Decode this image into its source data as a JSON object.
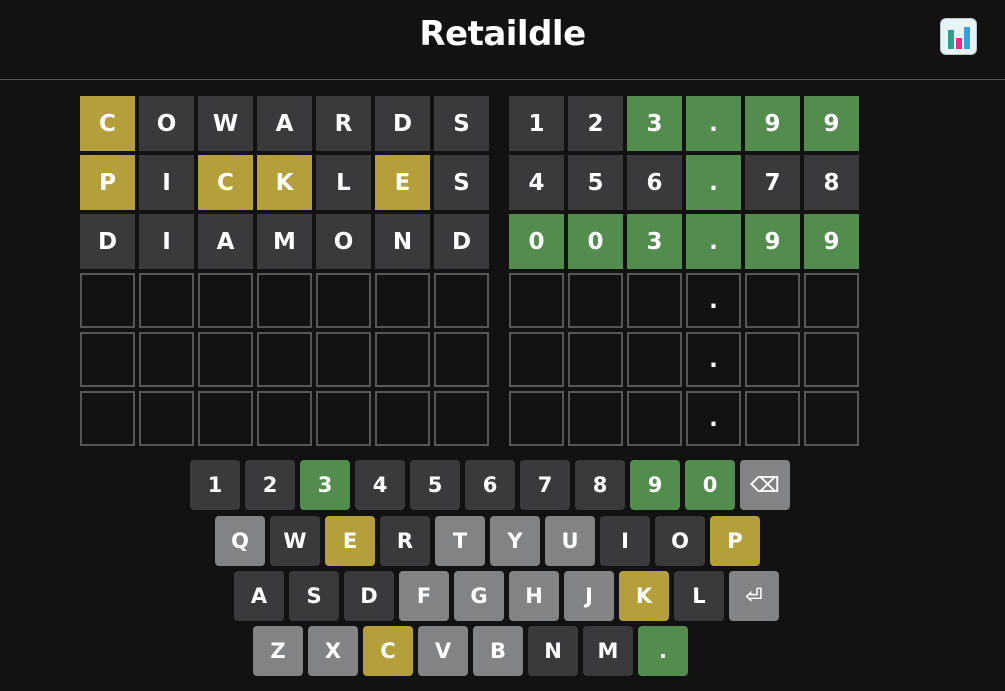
{
  "header": {
    "title": "Retaildle",
    "stats_icon": "bar-chart-icon"
  },
  "board": {
    "rows": [
      {
        "word": [
          [
            "C",
            "present"
          ],
          [
            "O",
            "filled"
          ],
          [
            "W",
            "filled"
          ],
          [
            "A",
            "filled"
          ],
          [
            "R",
            "filled"
          ],
          [
            "D",
            "filled"
          ],
          [
            "S",
            "filled"
          ]
        ],
        "price": [
          [
            "1",
            "filled"
          ],
          [
            "2",
            "filled"
          ],
          [
            "3",
            "correct"
          ],
          [
            ".",
            "correct"
          ],
          [
            "9",
            "correct"
          ],
          [
            "9",
            "correct"
          ]
        ]
      },
      {
        "word": [
          [
            "P",
            "present"
          ],
          [
            "I",
            "filled"
          ],
          [
            "C",
            "present"
          ],
          [
            "K",
            "present"
          ],
          [
            "L",
            "filled"
          ],
          [
            "E",
            "present"
          ],
          [
            "S",
            "filled"
          ]
        ],
        "price": [
          [
            "4",
            "filled"
          ],
          [
            "5",
            "filled"
          ],
          [
            "6",
            "filled"
          ],
          [
            ".",
            "correct"
          ],
          [
            "7",
            "filled"
          ],
          [
            "8",
            "filled"
          ]
        ]
      },
      {
        "word": [
          [
            "D",
            "filled"
          ],
          [
            "I",
            "filled"
          ],
          [
            "A",
            "filled"
          ],
          [
            "M",
            "filled"
          ],
          [
            "O",
            "filled"
          ],
          [
            "N",
            "filled"
          ],
          [
            "D",
            "filled"
          ]
        ],
        "price": [
          [
            "0",
            "correct"
          ],
          [
            "0",
            "correct"
          ],
          [
            "3",
            "correct"
          ],
          [
            ".",
            "correct"
          ],
          [
            "9",
            "correct"
          ],
          [
            "9",
            "correct"
          ]
        ]
      },
      {
        "word": [
          [
            "",
            "empty"
          ],
          [
            "",
            "empty"
          ],
          [
            "",
            "empty"
          ],
          [
            "",
            "empty"
          ],
          [
            "",
            "empty"
          ],
          [
            "",
            "empty"
          ],
          [
            "",
            "empty"
          ]
        ],
        "price": [
          [
            "",
            "empty"
          ],
          [
            "",
            "empty"
          ],
          [
            "",
            "empty"
          ],
          [
            ".",
            "empty"
          ],
          [
            "",
            "empty"
          ],
          [
            "",
            "empty"
          ]
        ]
      },
      {
        "word": [
          [
            "",
            "empty"
          ],
          [
            "",
            "empty"
          ],
          [
            "",
            "empty"
          ],
          [
            "",
            "empty"
          ],
          [
            "",
            "empty"
          ],
          [
            "",
            "empty"
          ],
          [
            "",
            "empty"
          ]
        ],
        "price": [
          [
            "",
            "empty"
          ],
          [
            "",
            "empty"
          ],
          [
            "",
            "empty"
          ],
          [
            ".",
            "empty"
          ],
          [
            "",
            "empty"
          ],
          [
            "",
            "empty"
          ]
        ]
      },
      {
        "word": [
          [
            "",
            "empty"
          ],
          [
            "",
            "empty"
          ],
          [
            "",
            "empty"
          ],
          [
            "",
            "empty"
          ],
          [
            "",
            "empty"
          ],
          [
            "",
            "empty"
          ],
          [
            "",
            "empty"
          ]
        ],
        "price": [
          [
            "",
            "empty"
          ],
          [
            "",
            "empty"
          ],
          [
            "",
            "empty"
          ],
          [
            ".",
            "empty"
          ],
          [
            "",
            "empty"
          ],
          [
            "",
            "empty"
          ]
        ]
      }
    ]
  },
  "keyboard": {
    "rows": [
      [
        [
          "1",
          "absent"
        ],
        [
          "2",
          "absent"
        ],
        [
          "3",
          "correct"
        ],
        [
          "4",
          "absent"
        ],
        [
          "5",
          "absent"
        ],
        [
          "6",
          "absent"
        ],
        [
          "7",
          "absent"
        ],
        [
          "8",
          "absent"
        ],
        [
          "9",
          "correct"
        ],
        [
          "0",
          "correct"
        ],
        [
          "⌫",
          "unused"
        ]
      ],
      [
        [
          "Q",
          "unused"
        ],
        [
          "W",
          "absent"
        ],
        [
          "E",
          "present"
        ],
        [
          "R",
          "absent"
        ],
        [
          "T",
          "unused"
        ],
        [
          "Y",
          "unused"
        ],
        [
          "U",
          "unused"
        ],
        [
          "I",
          "absent"
        ],
        [
          "O",
          "absent"
        ],
        [
          "P",
          "present"
        ]
      ],
      [
        [
          "A",
          "absent"
        ],
        [
          "S",
          "absent"
        ],
        [
          "D",
          "absent"
        ],
        [
          "F",
          "unused"
        ],
        [
          "G",
          "unused"
        ],
        [
          "H",
          "unused"
        ],
        [
          "J",
          "unused"
        ],
        [
          "K",
          "present"
        ],
        [
          "L",
          "absent"
        ],
        [
          "⏎",
          "unused"
        ]
      ],
      [
        [
          "Z",
          "unused"
        ],
        [
          "X",
          "unused"
        ],
        [
          "C",
          "present"
        ],
        [
          "V",
          "unused"
        ],
        [
          "B",
          "unused"
        ],
        [
          "N",
          "absent"
        ],
        [
          "M",
          "absent"
        ],
        [
          ".",
          "correct"
        ]
      ]
    ]
  },
  "colors": {
    "background": "#121213",
    "correct": "#538d4e",
    "present": "#b59f3b",
    "absent": "#3a3a3c",
    "unused": "#818384"
  }
}
